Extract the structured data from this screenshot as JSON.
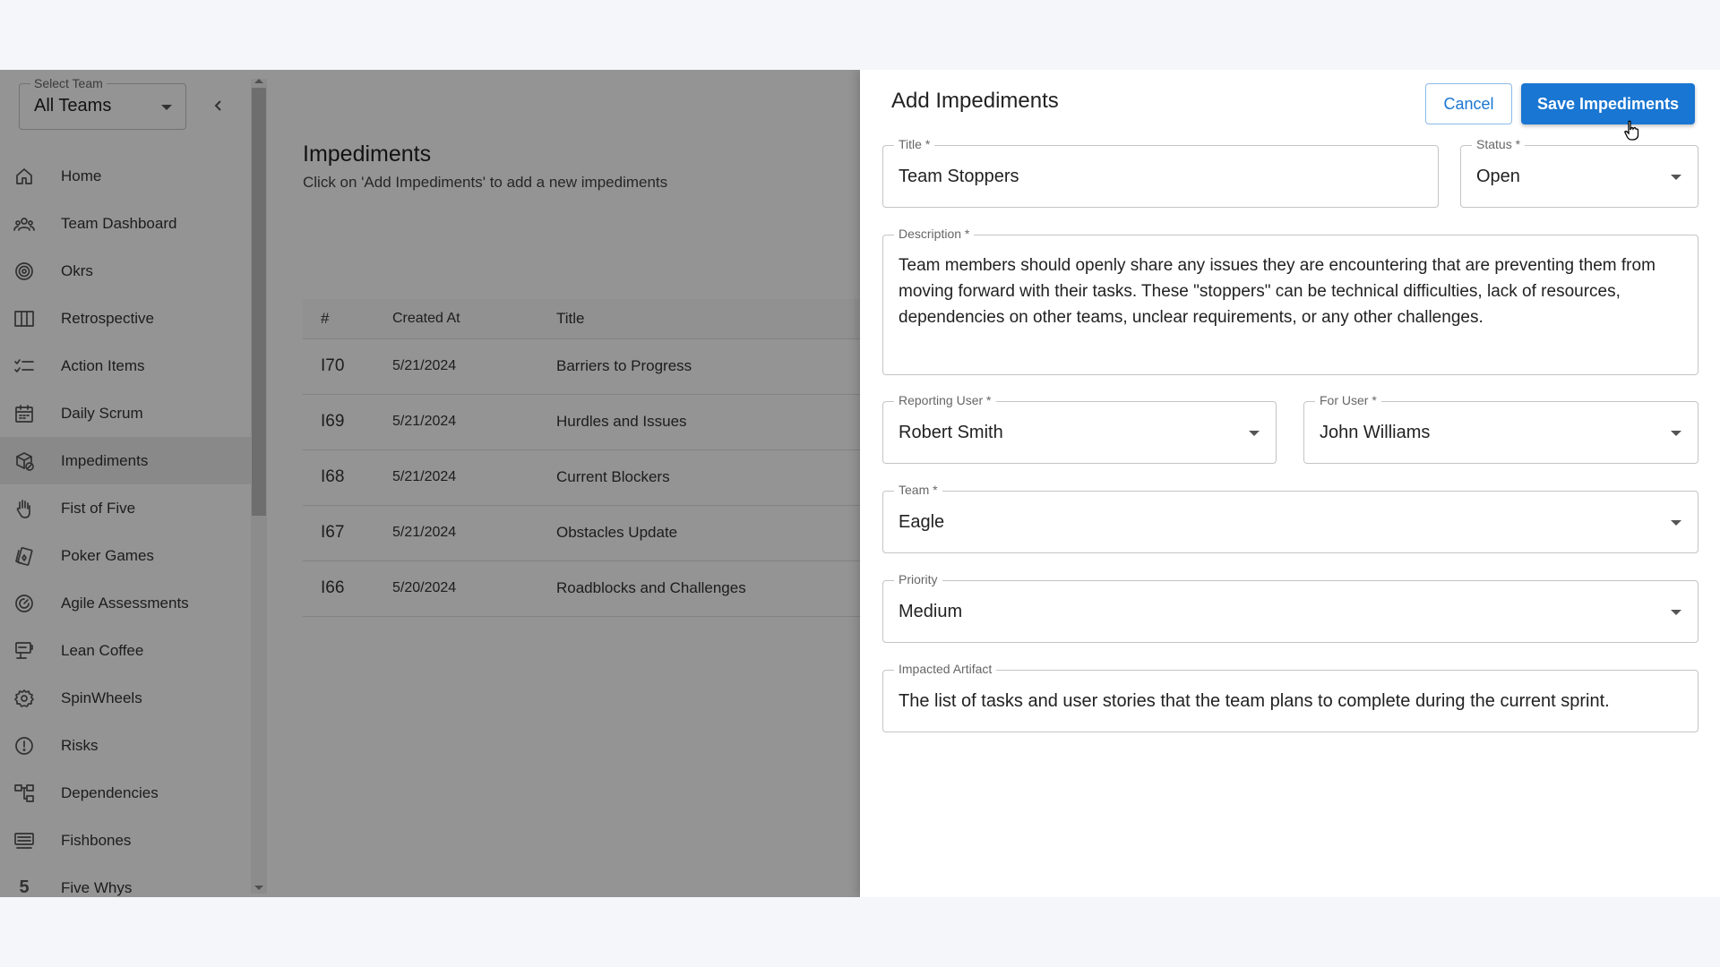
{
  "sidebar": {
    "team_select": {
      "label": "Select Team",
      "value": "All Teams"
    },
    "items": [
      {
        "label": "Home",
        "icon": "home-icon"
      },
      {
        "label": "Team Dashboard",
        "icon": "team-icon"
      },
      {
        "label": "Okrs",
        "icon": "target-icon"
      },
      {
        "label": "Retrospective",
        "icon": "columns-icon"
      },
      {
        "label": "Action Items",
        "icon": "checklist-icon"
      },
      {
        "label": "Daily Scrum",
        "icon": "calendar-icon"
      },
      {
        "label": "Impediments",
        "icon": "impediment-icon",
        "active": true
      },
      {
        "label": "Fist of Five",
        "icon": "hand-icon"
      },
      {
        "label": "Poker Games",
        "icon": "cards-icon"
      },
      {
        "label": "Agile Assessments",
        "icon": "gauge-icon"
      },
      {
        "label": "Lean Coffee",
        "icon": "coffee-icon"
      },
      {
        "label": "SpinWheels",
        "icon": "wheel-icon"
      },
      {
        "label": "Risks",
        "icon": "alert-circle-icon"
      },
      {
        "label": "Dependencies",
        "icon": "tree-icon"
      },
      {
        "label": "Fishbones",
        "icon": "fishbone-icon"
      },
      {
        "label": "Five Whys",
        "icon": "five-icon",
        "glyph": "5"
      }
    ]
  },
  "main": {
    "title": "Impediments",
    "subtitle": "Click on 'Add Impediments' to add a new impediments",
    "table": {
      "headers": [
        "#",
        "Created At",
        "Title"
      ],
      "rows": [
        [
          "I70",
          "5/21/2024",
          "Barriers to Progress"
        ],
        [
          "I69",
          "5/21/2024",
          "Hurdles and Issues"
        ],
        [
          "I68",
          "5/21/2024",
          "Current Blockers"
        ],
        [
          "I67",
          "5/21/2024",
          "Obstacles Update"
        ],
        [
          "I66",
          "5/20/2024",
          "Roadblocks and Challenges"
        ]
      ]
    }
  },
  "drawer": {
    "title": "Add Impediments",
    "cancel_label": "Cancel",
    "save_label": "Save Impediments",
    "fields": {
      "title": {
        "label": "Title *",
        "value": "Team Stoppers"
      },
      "status": {
        "label": "Status *",
        "value": "Open"
      },
      "description": {
        "label": "Description *",
        "value": "Team members should openly share any issues they are encountering that are preventing them from moving forward with their tasks. These \"stoppers\" can be technical difficulties, lack of resources, dependencies on other teams, unclear requirements, or any other challenges."
      },
      "reporting_user": {
        "label": "Reporting User *",
        "value": "Robert Smith"
      },
      "for_user": {
        "label": "For User *",
        "value": "John Williams"
      },
      "team": {
        "label": "Team *",
        "value": "Eagle"
      },
      "priority": {
        "label": "Priority",
        "value": "Medium"
      },
      "impacted_artifact": {
        "label": "Impacted Artifact",
        "value": "The list of tasks and user stories that the team plans to complete during the current sprint."
      }
    }
  },
  "colors": {
    "primary": "#1976d2",
    "overlay": "rgba(0,0,0,0.42)"
  }
}
